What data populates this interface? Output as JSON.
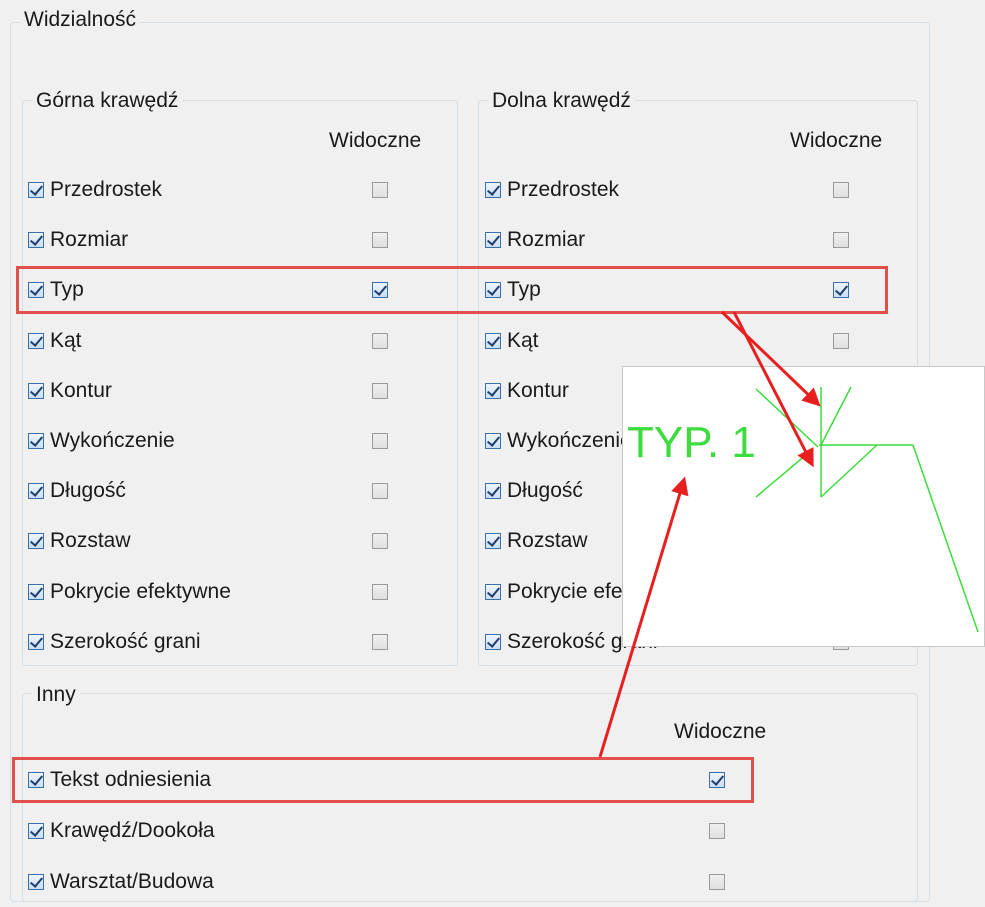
{
  "group_title": "Widzialność",
  "top_edge": {
    "title": "Górna krawędź",
    "visible_header": "Widoczne",
    "items": [
      {
        "label": "Przedrostek",
        "checked": true,
        "visible": false
      },
      {
        "label": "Rozmiar",
        "checked": true,
        "visible": false
      },
      {
        "label": "Typ",
        "checked": true,
        "visible": true
      },
      {
        "label": "Kąt",
        "checked": true,
        "visible": false
      },
      {
        "label": "Kontur",
        "checked": true,
        "visible": false
      },
      {
        "label": "Wykończenie",
        "checked": true,
        "visible": false
      },
      {
        "label": "Długość",
        "checked": true,
        "visible": false
      },
      {
        "label": "Rozstaw",
        "checked": true,
        "visible": false
      },
      {
        "label": "Pokrycie efektywne",
        "checked": true,
        "visible": false
      },
      {
        "label": "Szerokość grani",
        "checked": true,
        "visible": false
      }
    ]
  },
  "bottom_edge": {
    "title": "Dolna krawędź",
    "visible_header": "Widoczne",
    "items": [
      {
        "label": "Przedrostek",
        "checked": true,
        "visible": false
      },
      {
        "label": "Rozmiar",
        "checked": true,
        "visible": false
      },
      {
        "label": "Typ",
        "checked": true,
        "visible": true
      },
      {
        "label": "Kąt",
        "checked": true,
        "visible": false
      },
      {
        "label": "Kontur",
        "checked": true,
        "visible": false
      },
      {
        "label": "Wykończenie",
        "checked": true,
        "visible": false
      },
      {
        "label": "Długość",
        "checked": true,
        "visible": false
      },
      {
        "label": "Rozstaw",
        "checked": true,
        "visible": false
      },
      {
        "label": "Pokrycie efektywne",
        "checked": true,
        "visible": false
      },
      {
        "label": "Szerokość grani",
        "checked": true,
        "visible": false
      }
    ]
  },
  "other": {
    "title": "Inny",
    "visible_header": "Widoczne",
    "items": [
      {
        "label": "Tekst odniesienia",
        "checked": true,
        "visible": true
      },
      {
        "label": "Krawędź/Dookoła",
        "checked": true,
        "visible": false
      },
      {
        "label": "Warsztat/Budowa",
        "checked": true,
        "visible": false
      }
    ]
  },
  "preview": {
    "text": "TYP. 1",
    "line_color": "#3ddc3d"
  },
  "colors": {
    "highlight": "#e0514b",
    "arrow": "#e81f1f"
  }
}
